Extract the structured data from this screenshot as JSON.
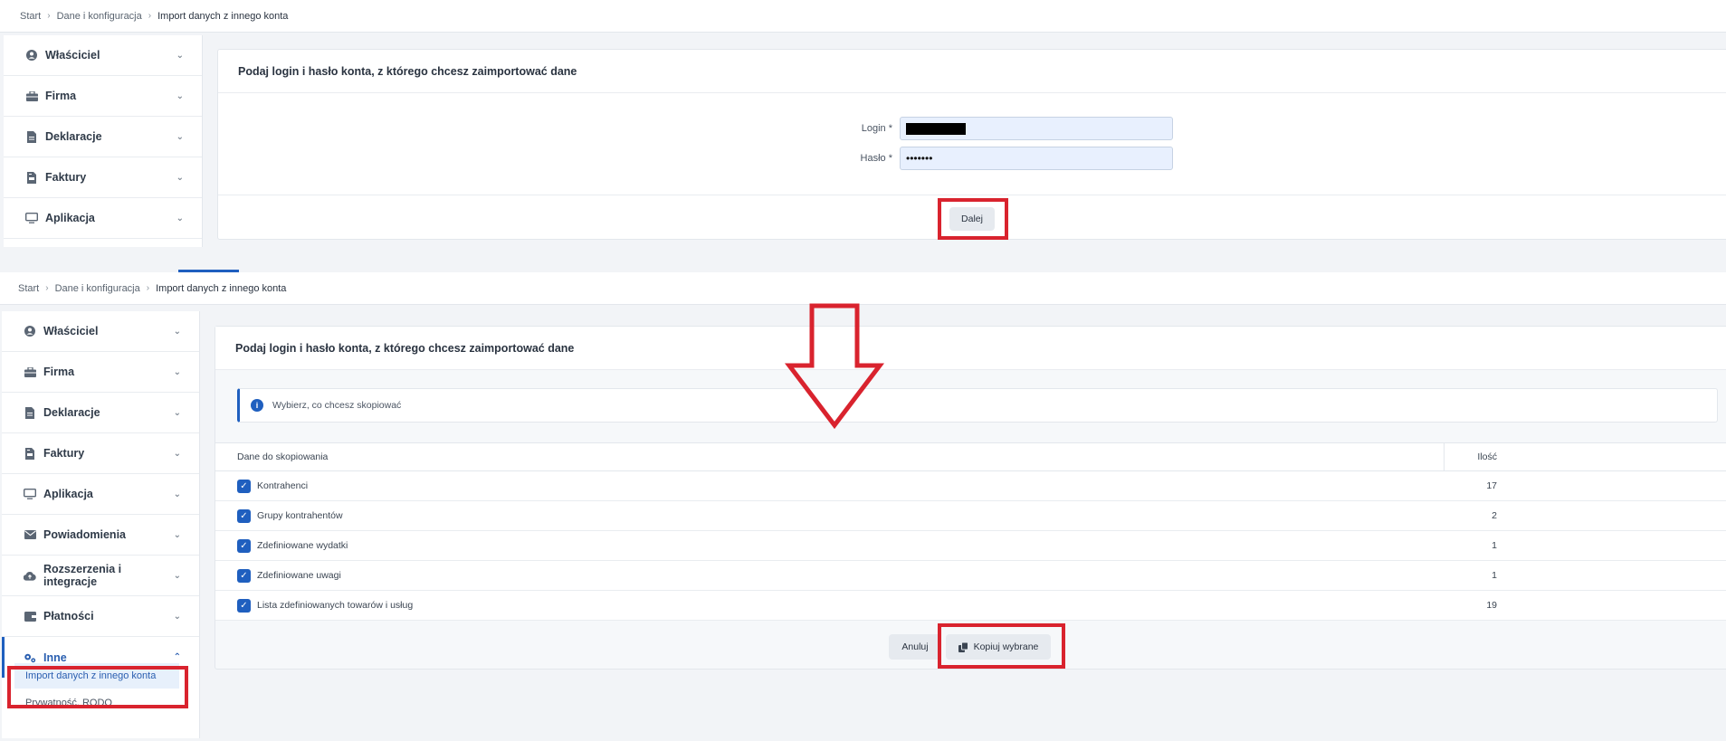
{
  "breadcrumb": {
    "start": "Start",
    "config": "Dane i konfiguracja",
    "current": "Import danych z innego konta"
  },
  "sidebar_top": [
    {
      "label": "Właściciel",
      "icon": "user-circle-icon"
    },
    {
      "label": "Firma",
      "icon": "briefcase-icon"
    },
    {
      "label": "Deklaracje",
      "icon": "document-icon"
    },
    {
      "label": "Faktury",
      "icon": "invoice-icon"
    },
    {
      "label": "Aplikacja",
      "icon": "monitor-icon"
    }
  ],
  "sidebar_bottom": [
    {
      "label": "Właściciel",
      "icon": "user-circle-icon"
    },
    {
      "label": "Firma",
      "icon": "briefcase-icon"
    },
    {
      "label": "Deklaracje",
      "icon": "document-icon"
    },
    {
      "label": "Faktury",
      "icon": "invoice-icon"
    },
    {
      "label": "Aplikacja",
      "icon": "monitor-icon"
    },
    {
      "label": "Powiadomienia",
      "icon": "envelope-icon"
    },
    {
      "label": "Rozszerzenia i integracje",
      "icon": "cloud-upload-icon"
    },
    {
      "label": "Płatności",
      "icon": "wallet-icon"
    },
    {
      "label": "Inne",
      "icon": "gears-icon"
    }
  ],
  "inne_submenu": {
    "import": "Import danych z innego konta",
    "privacy": "Prywatność, RODO"
  },
  "card_title": "Podaj login i hasło konta, z którego chcesz zaimportować dane",
  "form": {
    "login_label": "Login *",
    "password_label": "Hasło *",
    "password_value": "•••••••"
  },
  "buttons": {
    "next": "Dalej",
    "cancel": "Anuluj",
    "copy": "Kopiuj wybrane"
  },
  "info_text": "Wybierz, co chcesz skopiować",
  "table": {
    "header_name": "Dane do skopiowania",
    "header_qty": "Ilość",
    "rows": [
      {
        "name": "Kontrahenci",
        "qty": "17"
      },
      {
        "name": "Grupy kontrahentów",
        "qty": "2"
      },
      {
        "name": "Zdefiniowane wydatki",
        "qty": "1"
      },
      {
        "name": "Zdefiniowane uwagi",
        "qty": "1"
      },
      {
        "name": "Lista zdefiniowanych towarów i usług",
        "qty": "19"
      }
    ]
  },
  "colors": {
    "accent": "#1f5fbf",
    "highlight": "#d9232e"
  }
}
